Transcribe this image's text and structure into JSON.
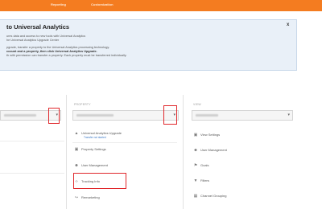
{
  "topnav": {
    "reporting": "Reporting",
    "customization": "Customization"
  },
  "notice": {
    "title": "to Universal Analytics",
    "line1": "ures data and access to new tools with Universal Analytics",
    "line2": "he Universal Analytics Upgrade Center",
    "line3": "pgrade, transfer a property to the Universal Analytics processing technology.",
    "line4": "ccount and a property, then click Universal Analytics Upgrade.",
    "line5": "th with permission can transfer a property. Each property must be transferred individually.",
    "close": "x"
  },
  "columns": {
    "property_header": "PROPERTY",
    "view_header": "VIEW"
  },
  "property_menu": [
    {
      "icon": "upgrade-icon",
      "label": "Universal Analytics Upgrade"
    },
    {
      "icon": "settings-icon",
      "label": "Property Settings"
    },
    {
      "icon": "users-icon",
      "label": "User Management"
    },
    {
      "icon": "code-icon",
      "label": "Tracking Info"
    },
    {
      "icon": "remarketing-icon",
      "label": "Remarketing"
    }
  ],
  "property_sublink": "Transfer not started",
  "view_menu": [
    {
      "icon": "settings-icon",
      "label": "View Settings"
    },
    {
      "icon": "users-icon",
      "label": "User Management"
    },
    {
      "icon": "goals-icon",
      "label": "Goals"
    },
    {
      "icon": "filter-icon",
      "label": "Filters"
    },
    {
      "icon": "grouping-icon",
      "label": "Channel Grouping"
    }
  ],
  "colors": {
    "topbar": "#f47c20",
    "highlight": "#e0272b",
    "link": "#3b78c5"
  }
}
